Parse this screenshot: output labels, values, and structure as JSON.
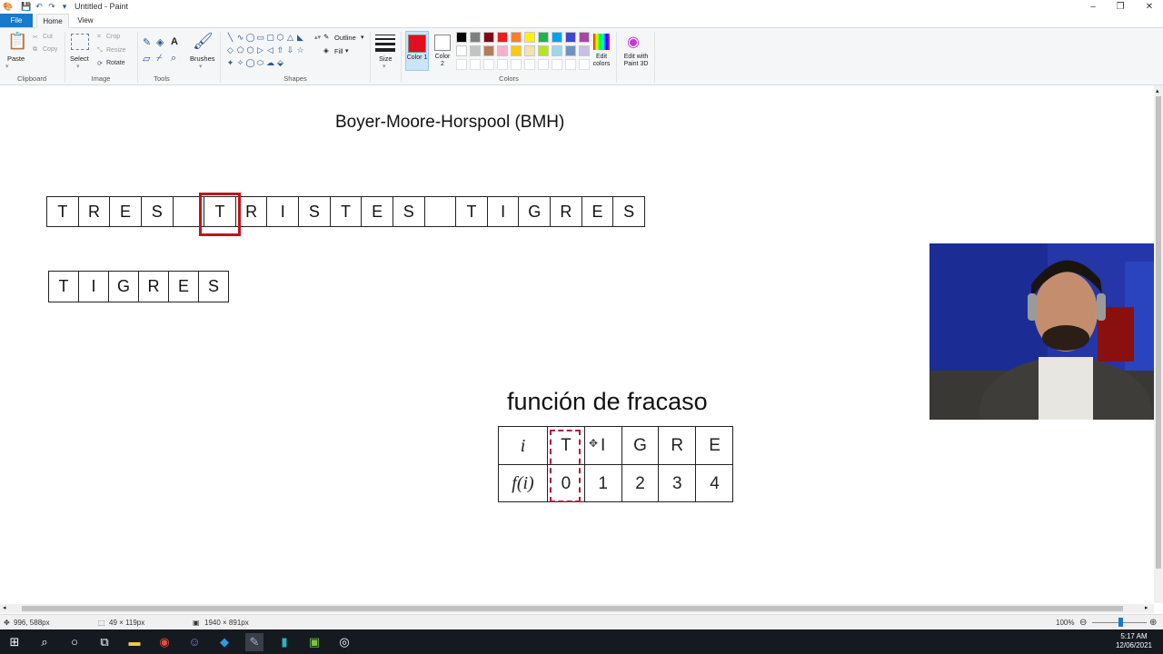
{
  "window": {
    "title": "Untitled - Paint",
    "controls": [
      "minimize-icon",
      "restore-icon",
      "close-icon"
    ]
  },
  "menu": {
    "tabs": [
      "File",
      "Home",
      "View"
    ]
  },
  "ribbon": {
    "clipboard": {
      "paste": "Paste",
      "cut": "Cut",
      "copy": "Copy",
      "group": "Clipboard"
    },
    "image": {
      "select": "Select",
      "crop": "Crop",
      "resize": "Resize",
      "rotate": "Rotate",
      "group": "Image"
    },
    "tools": {
      "group": "Tools"
    },
    "brushes": {
      "label": "Brushes"
    },
    "shapes": {
      "outline": "Outline",
      "fill": "Fill",
      "group": "Shapes"
    },
    "size": {
      "label": "Size"
    },
    "colors": {
      "color1_label": "Color 1",
      "color1_value": "#e0101e",
      "color2_label": "Color 2",
      "color2_value": "#ffffff",
      "edit_colors": "Edit colors",
      "group": "Colors",
      "palette": [
        "#000000",
        "#7f7f7f",
        "#880015",
        "#ed1c24",
        "#ff7f27",
        "#fff200",
        "#22b14c",
        "#00a2e8",
        "#3f48cc",
        "#a349a4",
        "#ffffff",
        "#c3c3c3",
        "#b97a57",
        "#ffaec9",
        "#ffc90e",
        "#efe4b0",
        "#b5e61d",
        "#99d9ea",
        "#7092be",
        "#c8bfe7"
      ]
    },
    "paint3d": "Edit with Paint 3D"
  },
  "canvas": {
    "title": "Boyer-Moore-Horspool (BMH)",
    "text_cells": [
      "T",
      "R",
      "E",
      "S",
      "",
      "T",
      "R",
      "I",
      "S",
      "T",
      "E",
      "S",
      "",
      "T",
      "I",
      "G",
      "R",
      "E",
      "S"
    ],
    "highlighted_text_index": 5,
    "pattern_cells": [
      "T",
      "I",
      "G",
      "R",
      "E",
      "S"
    ],
    "failure_title": "función de fracaso",
    "table": {
      "row_header_i": "i",
      "row_header_f": "f(i)",
      "letters": [
        "T",
        "I",
        "G",
        "R",
        "E"
      ],
      "values": [
        "0",
        "1",
        "2",
        "3",
        "4"
      ]
    }
  },
  "status": {
    "cursor_pos": "996, 588px",
    "selection_size": "49 × 119px",
    "image_size": "1940 × 891px",
    "zoom": "100%",
    "zoom_level": 0.5
  },
  "taskbar": {
    "time": "5:17 AM",
    "date": "12/06/2021",
    "apps": [
      "windows-start-icon",
      "search-icon",
      "cortana-icon",
      "task-view-icon",
      "file-explorer-icon",
      "chrome-icon",
      "discord-icon",
      "vscode-icon",
      "paint-icon",
      "terminal-icon",
      "android-studio-icon",
      "obs-icon"
    ]
  }
}
